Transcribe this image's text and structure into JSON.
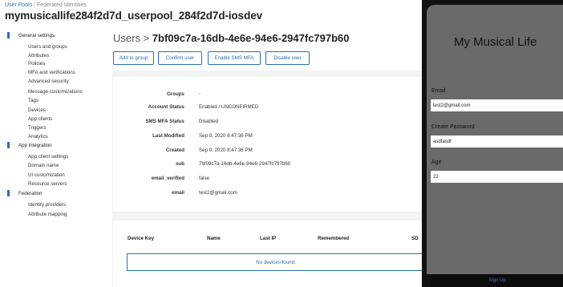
{
  "breadcrumb": {
    "user_pools": "User Pools",
    "separator": "|",
    "federated": "Federated Identities"
  },
  "pool_name": "mymusicallife284f2d7d_userpool_284f2d7d-iosdev",
  "sidebar": {
    "general_settings": "General settings",
    "general_items": [
      "Users and groups",
      "Attributes",
      "Policies",
      "MFA and verifications",
      "Advanced security",
      "Message customizations",
      "Tags",
      "Devices",
      "App clients",
      "Triggers",
      "Analytics"
    ],
    "app_integration": "App integration",
    "app_items": [
      "App client settings",
      "Domain name",
      "UI customization",
      "Resource servers"
    ],
    "federation": "Federation",
    "federation_items": [
      "Identity providers",
      "Attribute mapping"
    ]
  },
  "user_header": {
    "label": "Users",
    "chevron": ">",
    "id": "7bf09c7a-16db-4e6e-94e6-2947fc797b60"
  },
  "buttons": {
    "add_to_group": "Add to group",
    "confirm_user": "Confirm user",
    "enable_sms_mfa": "Enable SMS MFA",
    "disable_user": "Disable user"
  },
  "attributes": [
    {
      "label": "Groups",
      "value": "-"
    },
    {
      "label": "Account Status",
      "value": "Enabled / UNCONFIRMED"
    },
    {
      "label": "SMS MFA Status",
      "value": "Disabled"
    },
    {
      "label": "Last Modified",
      "value": "Sep 9, 2020 8:47:36 PM"
    },
    {
      "label": "Created",
      "value": "Sep 9, 2020 8:47:36 PM"
    },
    {
      "label": "sub",
      "value": "7bf09c7a-16db-4e6e-94e6-2947fc797b60"
    },
    {
      "label": "email_verified",
      "value": "false"
    },
    {
      "label": "email",
      "value": "test2@gmail.com"
    }
  ],
  "devices": {
    "headers": [
      "Device Key",
      "Name",
      "Last IP",
      "Remembered",
      "SD"
    ],
    "empty": "No devices found."
  },
  "app": {
    "title": "My Musical Life",
    "email_label": "Email",
    "email_value": "test2@gmail.com",
    "password_label": "Create Password",
    "password_value": "asdfasdf",
    "age_label": "Age",
    "age_value": "22",
    "signup": "Sign Up"
  },
  "colors": {
    "accent": "#2a6fb5",
    "panel": "#f2f3f3",
    "phone_bg": "#6a6a6a"
  }
}
